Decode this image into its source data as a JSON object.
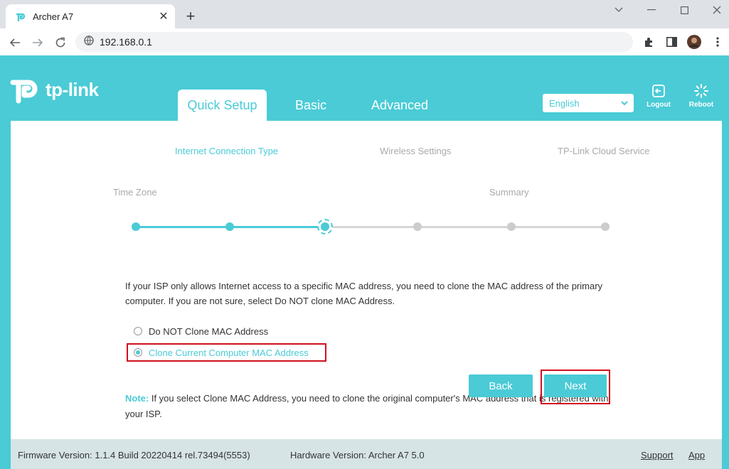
{
  "browser": {
    "tab_title": "Archer A7",
    "url": "192.168.0.1"
  },
  "header": {
    "logo_text": "tp-link",
    "nav_tabs": [
      {
        "label": "Quick Setup",
        "active": true
      },
      {
        "label": "Basic",
        "active": false
      },
      {
        "label": "Advanced",
        "active": false
      }
    ],
    "language": "English",
    "logout_label": "Logout",
    "reboot_label": "Reboot"
  },
  "wizard": {
    "steps": [
      {
        "label": "Time Zone",
        "state": "done"
      },
      {
        "label": "Internet Connection Type",
        "state": "done"
      },
      {
        "label": "",
        "state": "current"
      },
      {
        "label": "Wireless Settings",
        "state": "pending"
      },
      {
        "label": "Summary",
        "state": "pending"
      },
      {
        "label": "TP-Link Cloud Service",
        "state": "pending"
      }
    ]
  },
  "main": {
    "description": "If your ISP only allows Internet access to a specific MAC address, you need to clone the MAC address of the primary computer. If you are not sure, select Do NOT clone MAC Address.",
    "options": [
      {
        "label": "Do NOT Clone MAC Address",
        "selected": false
      },
      {
        "label": "Clone Current Computer MAC Address",
        "selected": true
      }
    ],
    "note_label": "Note:",
    "note_text": "If you select Clone MAC Address, you need to clone the original computer's MAC address that is registered with your ISP.",
    "back_label": "Back",
    "next_label": "Next"
  },
  "footer": {
    "firmware": "Firmware Version: 1.1.4 Build 20220414 rel.73494(5553)",
    "hardware": "Hardware Version: Archer A7 5.0",
    "support_label": "Support",
    "app_label": "App"
  },
  "colors": {
    "brand": "#4acbd6",
    "highlight": "#d0101c"
  }
}
